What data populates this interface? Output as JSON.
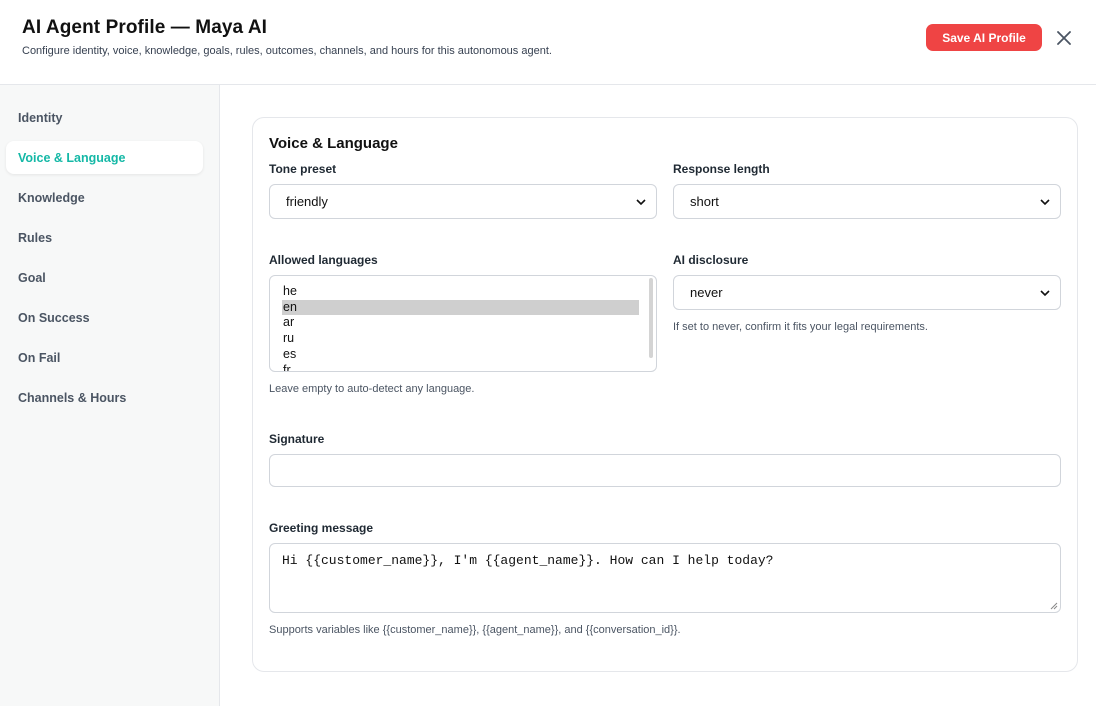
{
  "header": {
    "title": "AI Agent Profile — Maya AI",
    "subtitle": "Configure identity, voice, knowledge, goals, rules, outcomes, channels, and hours for this autonomous agent.",
    "save_label": "Save AI Profile"
  },
  "sidebar": {
    "items": [
      {
        "label": "Identity"
      },
      {
        "label": "Voice & Language"
      },
      {
        "label": "Knowledge"
      },
      {
        "label": "Rules"
      },
      {
        "label": "Goal"
      },
      {
        "label": "On Success"
      },
      {
        "label": "On Fail"
      },
      {
        "label": "Channels & Hours"
      }
    ],
    "active_index": 1
  },
  "section": {
    "title": "Voice & Language",
    "tone": {
      "label": "Tone preset",
      "value": "friendly"
    },
    "length": {
      "label": "Response length",
      "value": "short"
    },
    "languages": {
      "label": "Allowed languages",
      "options": [
        "he",
        "en",
        "ar",
        "ru",
        "es",
        "fr"
      ],
      "selected": [
        "en"
      ],
      "help": "Leave empty to auto-detect any language."
    },
    "disclosure": {
      "label": "AI disclosure",
      "value": "never",
      "help": "If set to never, confirm it fits your legal requirements."
    },
    "signature": {
      "label": "Signature",
      "value": ""
    },
    "greeting": {
      "label": "Greeting message",
      "value": "Hi {{customer_name}}, I'm {{agent_name}}. How can I help today?",
      "help": "Supports variables like {{customer_name}}, {{agent_name}}, and {{conversation_id}}."
    }
  },
  "colors": {
    "accent": "#14b8a6",
    "save_button": "#ef4444"
  }
}
